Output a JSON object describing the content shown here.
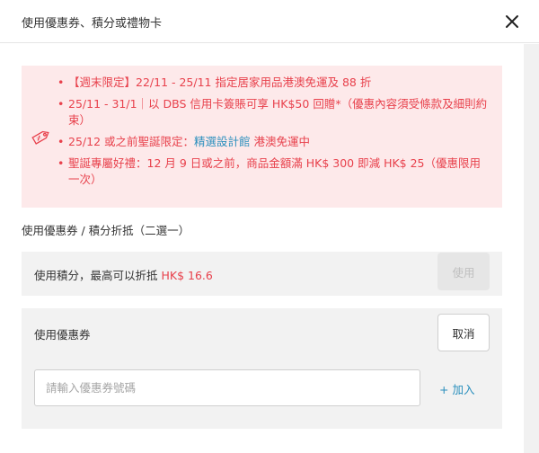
{
  "header": {
    "title": "使用優惠券、積分或禮物卡",
    "close_icon": "close-icon"
  },
  "promo": {
    "tag_icon": "promo-tag-icon",
    "items": [
      {
        "text": "【週末限定】22/11 - 25/11 指定居家用品港澳免運及 88 折"
      },
      {
        "text": "25/11 - 31/1｜以 DBS 信用卡簽賬可享 HK$50 回贈*（優惠內容須受條款及細則約束）"
      },
      {
        "prefix": "25/12 或之前聖誕限定：",
        "link": "精選設計館",
        "suffix": " 港澳免運中"
      },
      {
        "text": "聖誕專屬好禮：12 月 9 日或之前，商品金額滿 HK$ 300 即減 HK$ 25（優惠限用一次）"
      }
    ],
    "colors": {
      "background": "#fde9ea",
      "text": "#e8414c",
      "link": "#2a8fbd"
    }
  },
  "section_label": "使用優惠券 / 積分折抵（二選一）",
  "points": {
    "label": "使用積分，最高可以折抵",
    "amount": "HK$ 16.6",
    "button_label": "使用"
  },
  "coupon": {
    "label": "使用優惠券",
    "cancel_label": "取消",
    "input_placeholder": "請輸入優惠券號碼",
    "input_value": "",
    "add_label": "+ 加入"
  }
}
